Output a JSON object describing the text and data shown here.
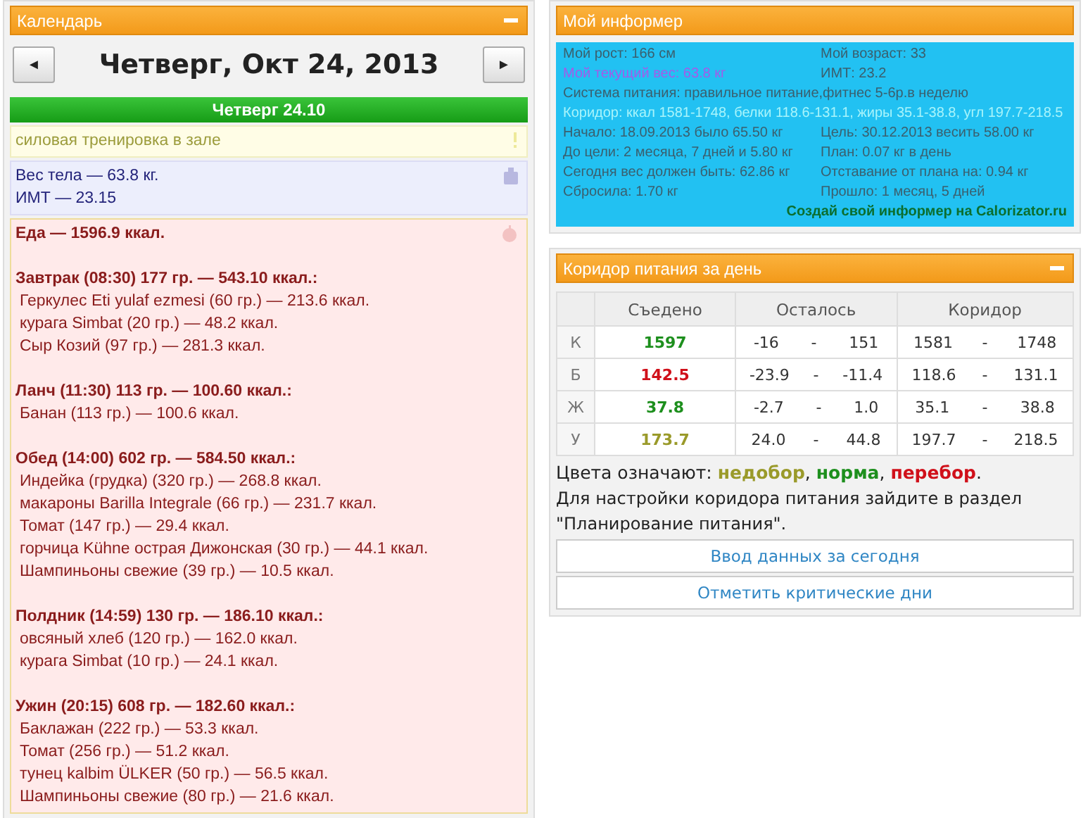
{
  "calendar": {
    "title": "Календарь",
    "date": "Четверг, Окт 24, 2013",
    "prev": "◄",
    "next": "►",
    "day_title": "Четверг 24.10",
    "events": [
      {
        "kind": "note",
        "lines": [
          "силовая тренировка в зале"
        ]
      },
      {
        "kind": "weight",
        "lines": [
          "Вес тела — 63.8 кг.",
          "ИМТ — 23.15"
        ]
      },
      {
        "kind": "food",
        "title": "Еда — 1596.9 ккал.",
        "meals": [
          {
            "heading": "Завтрак (08:30) 177 гр. — 543.10 ккал.:",
            "items": [
              "Геркулес Eti yulaf ezmesi (60 гр.) — 213.6 ккал.",
              "курага Simbat (20 гр.) — 48.2 ккал.",
              "Сыр Козий (97 гр.) — 281.3 ккал."
            ]
          },
          {
            "heading": "Ланч (11:30) 113 гр. — 100.60 ккал.:",
            "items": [
              "Банан (113 гр.) — 100.6 ккал."
            ]
          },
          {
            "heading": "Обед (14:00) 602 гр. — 584.50 ккал.:",
            "items": [
              "Индейка (грудка) (320 гр.) — 268.8 ккал.",
              "макароны Barilla Integrale (66 гр.) — 231.7 ккал.",
              "Томат (147 гр.) — 29.4 ккал.",
              "горчица Kühne острая Дижонская (30 гр.) — 44.1 ккал.",
              "Шампиньоны свежие (39 гр.) — 10.5 ккал."
            ]
          },
          {
            "heading": "Полдник (14:59) 130 гр. — 186.10 ккал.:",
            "items": [
              "овсяный хлеб (120 гр.) — 162.0 ккал.",
              "курага Simbat (10 гр.) — 24.1 ккал."
            ]
          },
          {
            "heading": "Ужин (20:15) 608 гр. — 182.60 ккал.:",
            "items": [
              "Баклажан (222 гр.) — 53.3 ккал.",
              "Томат (256 гр.) — 51.2 ккал.",
              "тунец kalbim ÜLKER (50 гр.) — 56.5 ккал.",
              "Шампиньоны свежие (80 гр.) — 21.6 ккал."
            ]
          }
        ]
      }
    ]
  },
  "informer": {
    "title": "Мой информер",
    "rows": [
      {
        "cells": [
          {
            "text": "Мой рост: 166 см",
            "color": "#3a5f6e"
          },
          {
            "text": "Мой возраст: 33",
            "color": "#3a5f6e"
          }
        ]
      },
      {
        "cells": [
          {
            "text": "Мой текущий вес: 63.8 кг",
            "color": "#a35be9"
          },
          {
            "text": "ИМТ: 23.2",
            "color": "#3a5f6e"
          }
        ]
      },
      {
        "cells": [
          {
            "text": "Система питания: правильное питание,фитнес 5-6р.в неделю",
            "color": "#3a5f6e"
          }
        ]
      },
      {
        "cells": [
          {
            "text": "Коридор: ккал 1581-1748, белки 118.6-131.1, жиры 35.1-38.8, угл 197.7-218.5",
            "color": "#a8f4fb"
          }
        ]
      },
      {
        "cells": [
          {
            "text": "Начало: 18.09.2013 было 65.50 кг",
            "color": "#3a5f6e"
          },
          {
            "text": "Цель: 30.12.2013 весить 58.00 кг",
            "color": "#3a5f6e"
          }
        ]
      },
      {
        "cells": [
          {
            "text": "До цели: 2 месяца, 7 дней и 5.80 кг",
            "color": "#3a5f6e"
          },
          {
            "text": "План: 0.07 кг в день",
            "color": "#3a5f6e"
          }
        ]
      },
      {
        "cells": [
          {
            "text": "Сегодня вес должен быть: 62.86 кг",
            "color": "#3a5f6e"
          },
          {
            "text": "Отставание от плана на: 0.94 кг",
            "color": "#3a5f6e"
          }
        ]
      },
      {
        "cells": [
          {
            "text": "Сбросила: 1.70 кг",
            "color": "#3a5f6e"
          },
          {
            "text": "Прошло: 1 месяц, 5 дней",
            "color": "#3a5f6e"
          }
        ]
      }
    ],
    "link": "Создай свой информер на Calorizator.ru"
  },
  "corridor": {
    "title": "Коридор питания за день",
    "columns": [
      "Съедено",
      "Осталось",
      "Коридор"
    ],
    "rows": [
      {
        "label": "К",
        "eaten": "1597",
        "color": "#1d8f1d",
        "left_min": "-16",
        "left_max": "151",
        "range_min": "1581",
        "range_max": "1748"
      },
      {
        "label": "Б",
        "eaten": "142.5",
        "color": "#d0101a",
        "left_min": "-23.9",
        "left_max": "-11.4",
        "range_min": "118.6",
        "range_max": "131.1"
      },
      {
        "label": "Ж",
        "eaten": "37.8",
        "color": "#1d8f1d",
        "left_min": "-2.7",
        "left_max": "1.0",
        "range_min": "35.1",
        "range_max": "38.8"
      },
      {
        "label": "У",
        "eaten": "173.7",
        "color": "#9a9a2a",
        "left_min": "24.0",
        "left_max": "44.8",
        "range_min": "197.7",
        "range_max": "218.5"
      }
    ],
    "separator": "-",
    "legend_label": "Цвета означают:",
    "legend": [
      {
        "text": "недобор",
        "color": "#9a9a2a",
        "after": ","
      },
      {
        "text": "норма",
        "color": "#1d8f1d",
        "after": ","
      },
      {
        "text": "перебор",
        "color": "#d0101a",
        "after": "."
      }
    ],
    "note": "Для настройки коридора питания зайдите в раздел \"Планирование питания\".",
    "buttons": [
      "Ввод данных за сегодня",
      "Отметить критические дни"
    ]
  }
}
